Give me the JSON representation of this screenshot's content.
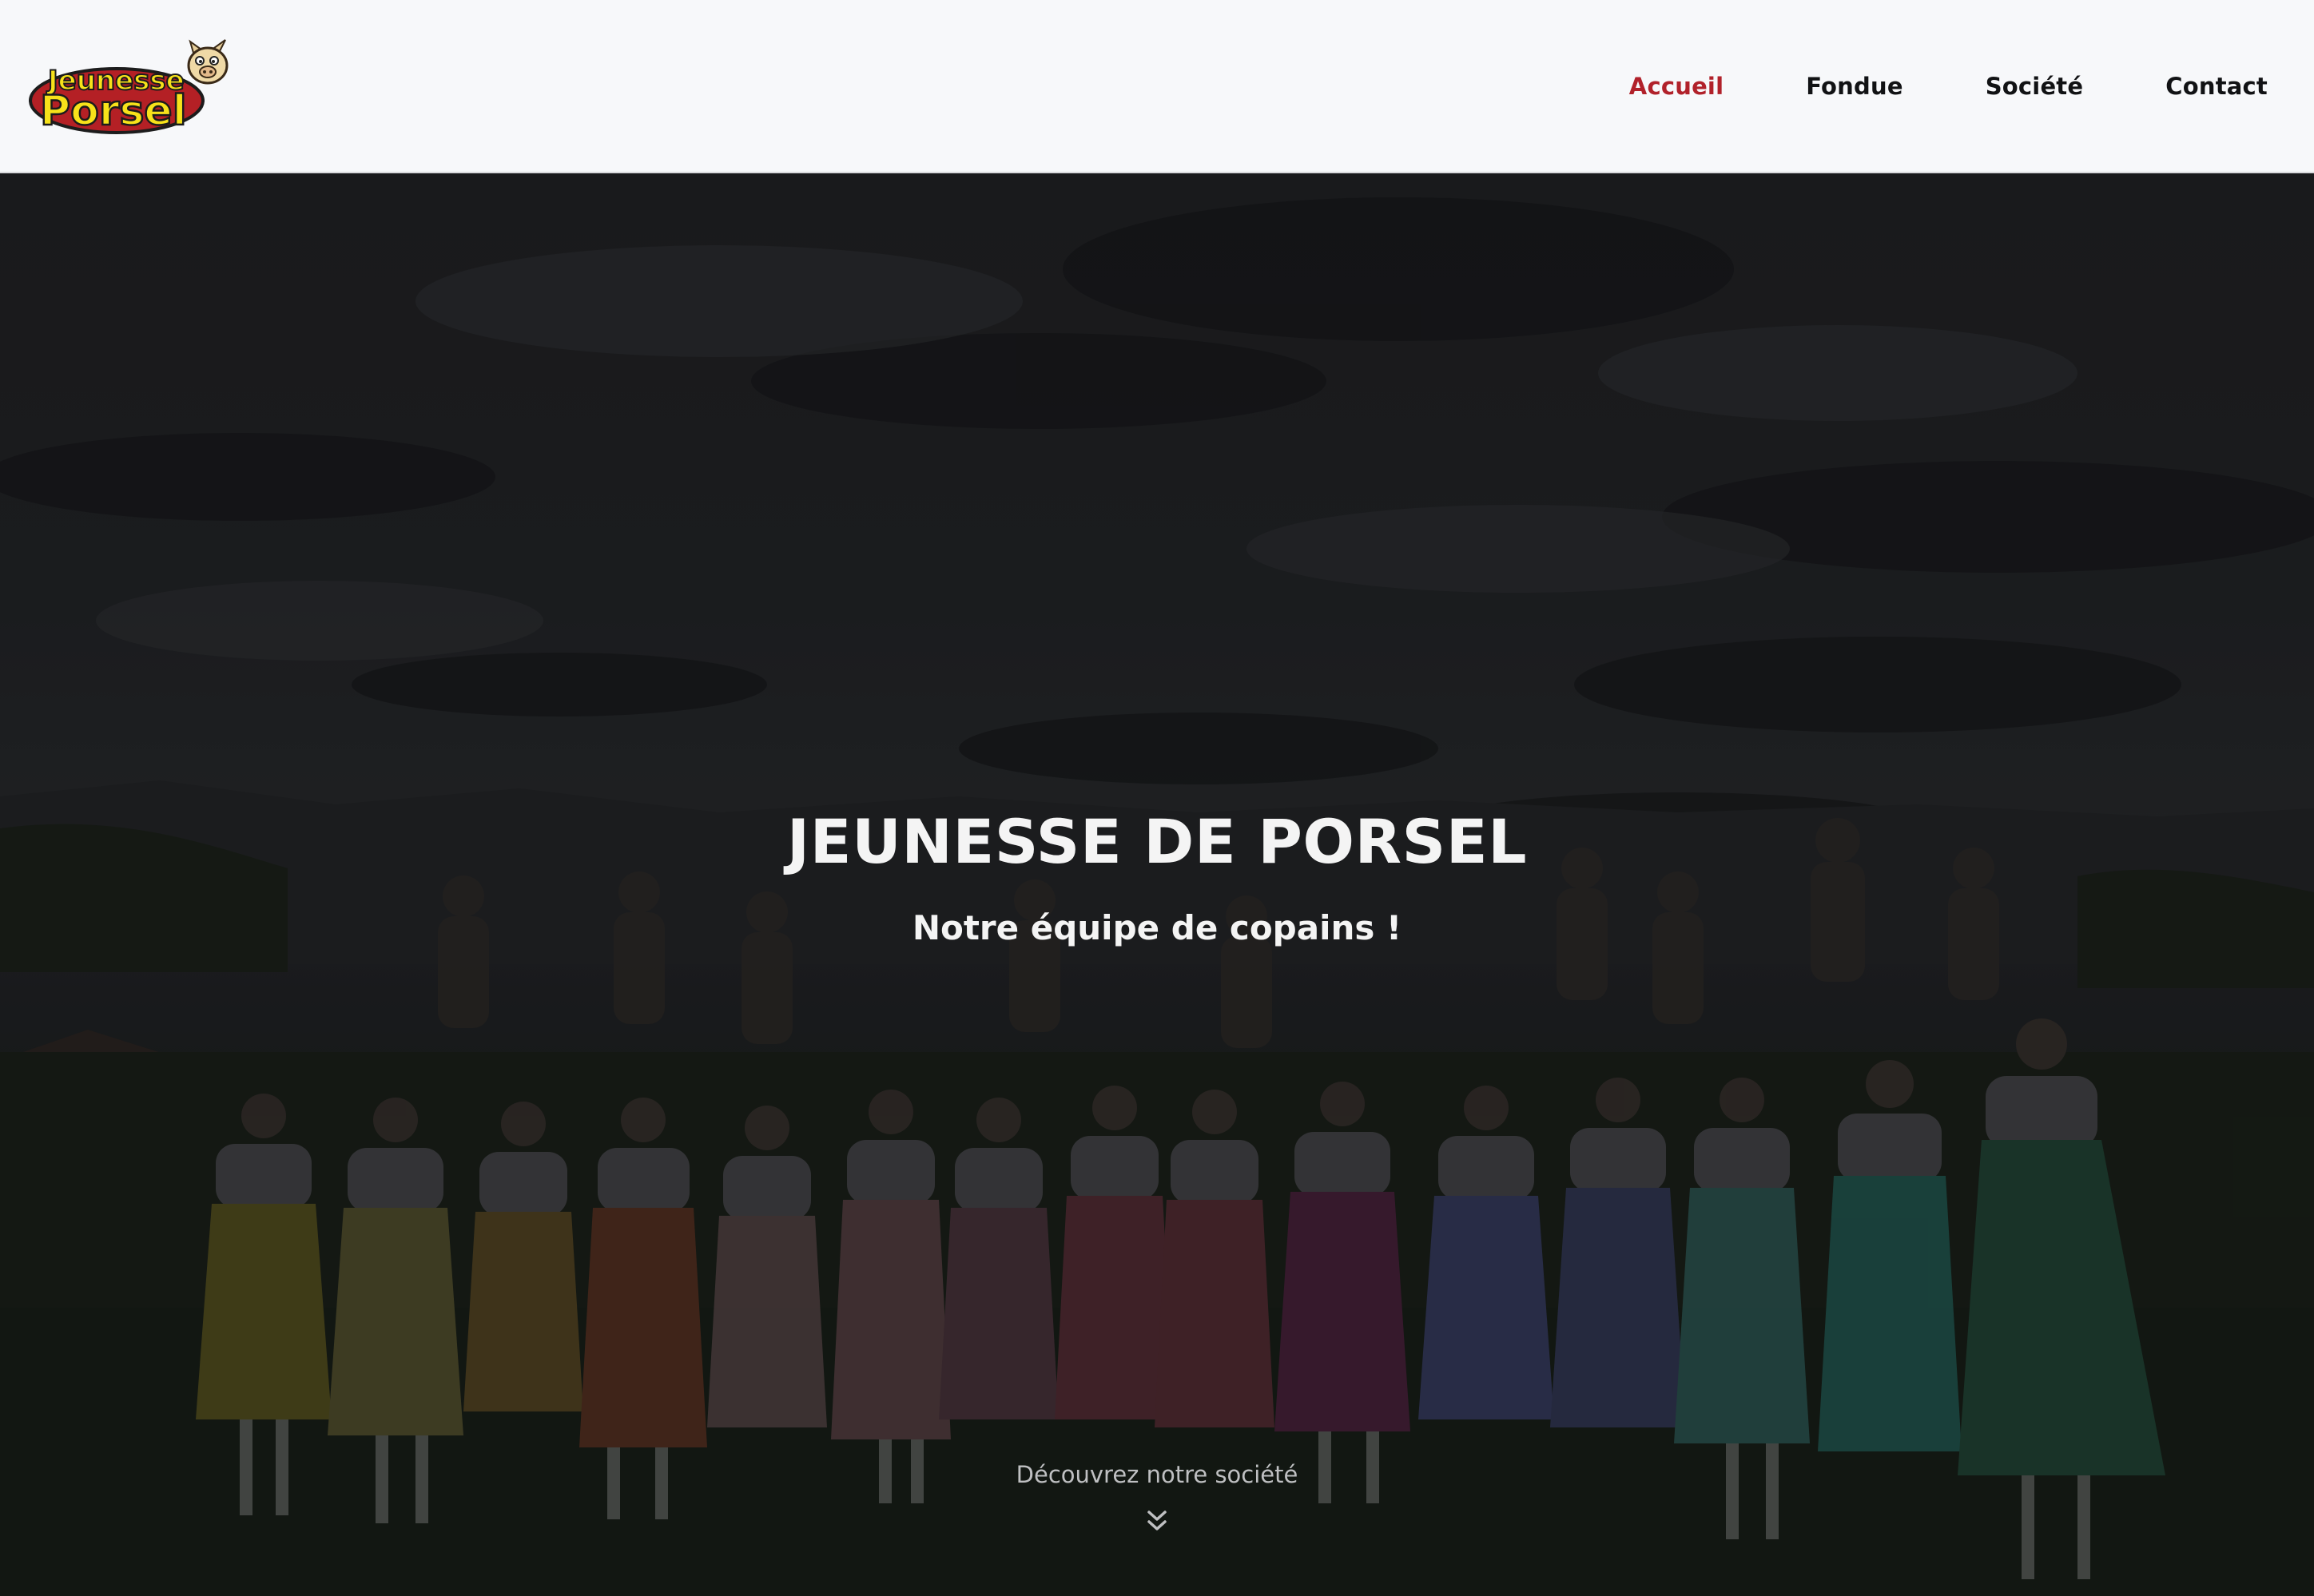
{
  "header": {
    "logo": {
      "line1": "Jeunesse",
      "line2": "Porsel",
      "icon": "pig-mascot-logo"
    },
    "nav": [
      {
        "label": "Accueil",
        "active": true
      },
      {
        "label": "Fondue",
        "active": false
      },
      {
        "label": "Société",
        "active": false
      },
      {
        "label": "Contact",
        "active": false
      }
    ]
  },
  "hero": {
    "title": "JEUNESSE DE PORSEL",
    "subtitle": "Notre équipe de copains !",
    "cta": {
      "label": "Découvrez notre société",
      "icon": "double-chevron-down-icon"
    }
  },
  "colors": {
    "accent": "#b1212a",
    "logo_yellow": "#f7e21a",
    "navbar_bg": "#f7f8fa",
    "nav_text": "#111214"
  }
}
